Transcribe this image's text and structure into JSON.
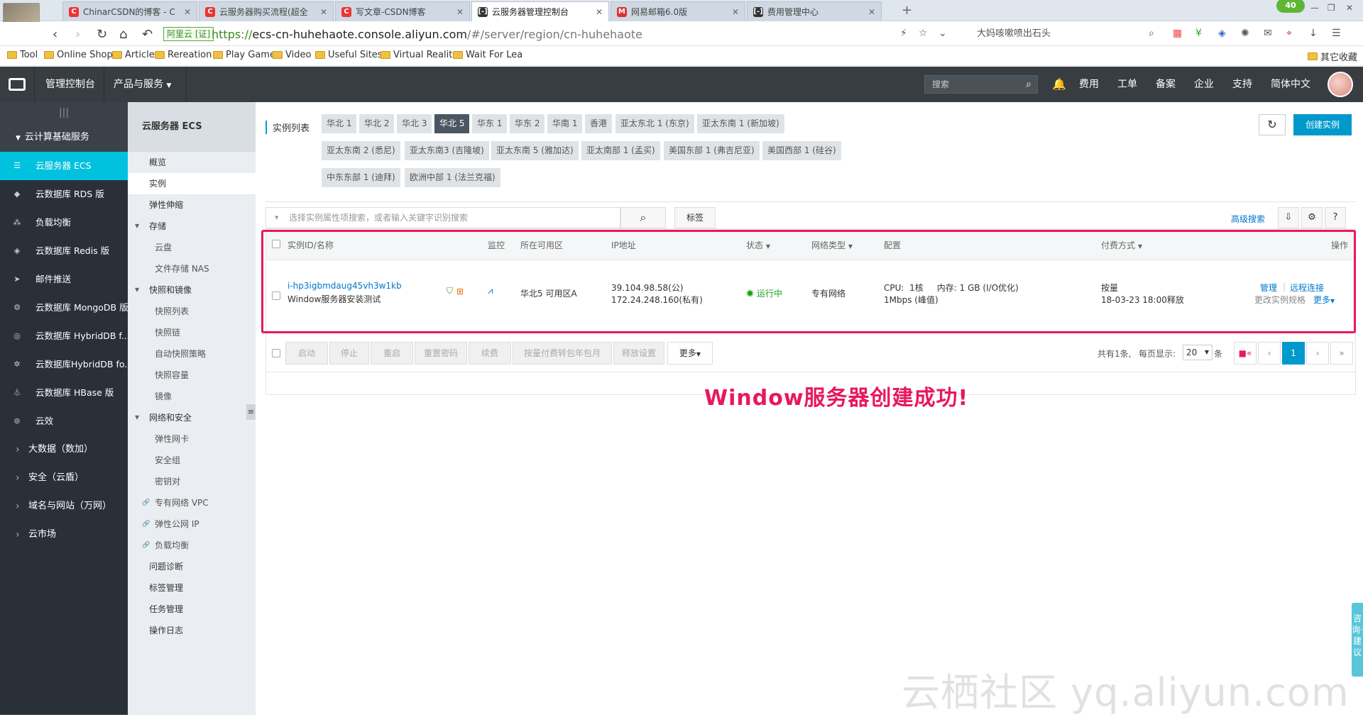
{
  "browser": {
    "tabs": [
      {
        "label": "ChinarCSDN的博客 - C",
        "icon": "csdn-icon",
        "color": "#e33"
      },
      {
        "label": "云服务器购买流程(超全",
        "icon": "csdn-icon",
        "color": "#e33"
      },
      {
        "label": "写文章-CSDN博客",
        "icon": "csdn-icon",
        "color": "#e33"
      },
      {
        "label": "云服务器管理控制台",
        "icon": "aliyun-icon",
        "color": "#333"
      },
      {
        "label": "网易邮箱6.0版",
        "icon": "netease-icon",
        "color": "#d33"
      },
      {
        "label": "费用管理中心",
        "icon": "aliyun-icon",
        "color": "#333"
      }
    ],
    "badge": "40",
    "secure_label": "阿里云 [证]",
    "url_prefix": "https://",
    "url_host": "ecs-cn-huhehaote.console.aliyun.com",
    "url_path": "/#/server/region/cn-huhehaote",
    "search_text": "大妈咳嗽喷出石头",
    "bookmarks": [
      "Tool",
      "Online Shop",
      "Article",
      "Rereation",
      "Play Game",
      "Video",
      "Useful Sites",
      "Virtual Realit",
      "Wait For Lea"
    ],
    "other_bookmarks": "其它收藏"
  },
  "topbar": {
    "console": "管理控制台",
    "products": "产品与服务",
    "search_placeholder": "搜索",
    "menu": [
      "费用",
      "工单",
      "备案",
      "企业",
      "支持",
      "简体中文"
    ]
  },
  "sidebar": {
    "group": "云计算基础服务",
    "items": [
      {
        "label": "云服务器 ECS",
        "icon": "server-icon"
      },
      {
        "label": "云数据库 RDS 版",
        "icon": "database-icon"
      },
      {
        "label": "负载均衡",
        "icon": "balance-icon"
      },
      {
        "label": "云数据库 Redis 版",
        "icon": "redis-icon"
      },
      {
        "label": "邮件推送",
        "icon": "mail-icon"
      },
      {
        "label": "云数据库 MongoDB 版",
        "icon": "mongodb-icon"
      },
      {
        "label": "云数据库 HybridDB f...",
        "icon": "hybriddb-icon"
      },
      {
        "label": "云数据库HybridDB fo...",
        "icon": "hybriddb2-icon"
      },
      {
        "label": "云数据库 HBase 版",
        "icon": "hbase-icon"
      },
      {
        "label": "云效",
        "icon": "devops-icon"
      }
    ],
    "categories": [
      "大数据（数加）",
      "安全（云盾）",
      "域名与网站（万网）",
      "云市场"
    ]
  },
  "subnav": {
    "title": "云服务器 ECS",
    "items": [
      {
        "label": "概览",
        "type": "item"
      },
      {
        "label": "实例",
        "type": "item"
      },
      {
        "label": "弹性伸缩",
        "type": "item"
      },
      {
        "label": "存储",
        "type": "grp"
      },
      {
        "label": "云盘",
        "type": "sub"
      },
      {
        "label": "文件存储 NAS",
        "type": "sub"
      },
      {
        "label": "快照和镜像",
        "type": "grp"
      },
      {
        "label": "快照列表",
        "type": "sub"
      },
      {
        "label": "快照链",
        "type": "sub"
      },
      {
        "label": "自动快照策略",
        "type": "sub"
      },
      {
        "label": "快照容量",
        "type": "sub"
      },
      {
        "label": "镜像",
        "type": "sub"
      },
      {
        "label": "网络和安全",
        "type": "grp"
      },
      {
        "label": "弹性网卡",
        "type": "sub"
      },
      {
        "label": "安全组",
        "type": "sub"
      },
      {
        "label": "密钥对",
        "type": "sub"
      },
      {
        "label": "专有网络 VPC",
        "type": "lnk"
      },
      {
        "label": "弹性公网 IP",
        "type": "lnk"
      },
      {
        "label": "负载均衡",
        "type": "lnk"
      },
      {
        "label": "问题诊断",
        "type": "item"
      },
      {
        "label": "标签管理",
        "type": "item"
      },
      {
        "label": "任务管理",
        "type": "item"
      },
      {
        "label": "操作日志",
        "type": "item"
      }
    ]
  },
  "main": {
    "list_title": "实例列表",
    "regions_row1": [
      "华北 1",
      "华北 2",
      "华北 3",
      "华北 5",
      "华东 1",
      "华东 2",
      "华南 1",
      "香港",
      "亚太东北 1 (东京)",
      "亚太东南 1 (新加坡)"
    ],
    "regions_row2": [
      "亚太东南 2 (悉尼)",
      "亚太东南3 (吉隆坡)",
      "亚太东南 5 (雅加达)",
      "亚太南部 1 (孟买)",
      "美国东部 1 (弗吉尼亚)",
      "美国西部 1 (硅谷)"
    ],
    "regions_row3": [
      "中东东部 1 (迪拜)",
      "欧洲中部 1 (法兰克福)"
    ],
    "active_region": "华北 5",
    "create_label": "创建实例",
    "search_placeholder": "选择实例属性项搜索，或者输入关键字识别搜索",
    "tag_label": "标签",
    "advanced_search": "高级搜索",
    "columns": [
      "实例ID/名称",
      "监控",
      "所在可用区",
      "IP地址",
      "状态",
      "网络类型",
      "配置",
      "付费方式",
      "操作"
    ],
    "instance": {
      "id": "i-hp3igbmdaug45vh3w1kb",
      "name": "Window服务器安装测试",
      "zone": "华北5 可用区A",
      "ip_public": "39.104.98.58(公)",
      "ip_private": "172.24.248.160(私有)",
      "status": "运行中",
      "network": "专有网络",
      "config_line1": "CPU:  1核     内存: 1 GB (I/O优化)",
      "config_line2": "1Mbps (峰值)",
      "billing": "按量",
      "release": "18-03-23 18:00释放",
      "op_manage": "管理",
      "op_remote": "远程连接",
      "op_change": "更改实例规格",
      "op_more": "更多"
    },
    "actions": [
      "启动",
      "停止",
      "重启",
      "重置密码",
      "续费",
      "按量付费转包年包月",
      "释放设置"
    ],
    "more_label": "更多",
    "total_text": "共有1条,",
    "per_page_label": "每页显示:",
    "per_page": "20",
    "per_page_unit": "条",
    "current_page": "1",
    "success_message": "Window服务器创建成功!",
    "watermark": "云栖社区 yq.aliyun.com",
    "consult": "咨询·建议"
  }
}
